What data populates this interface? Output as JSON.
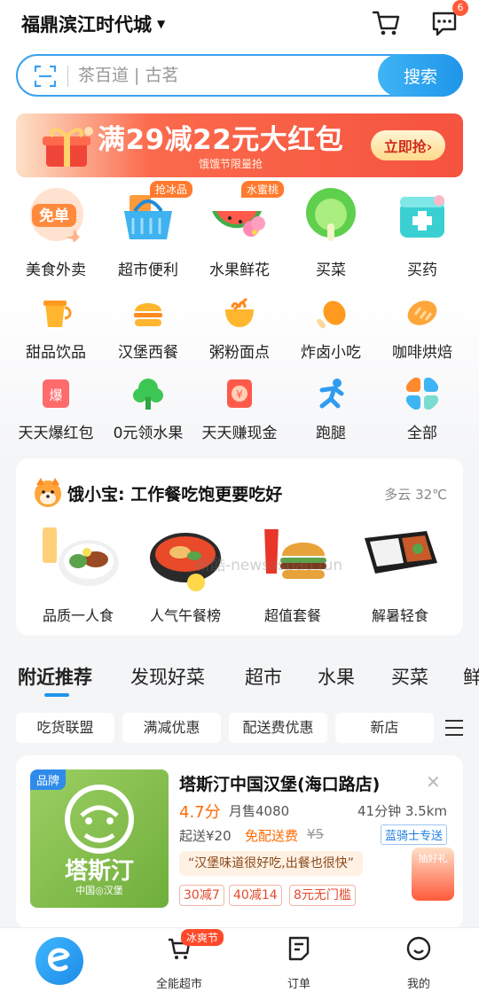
{
  "header": {
    "location": "福鼎滨江时代城",
    "message_count": "6"
  },
  "search": {
    "placeholder": "茶百道 | 古茗",
    "button": "搜索"
  },
  "banner": {
    "main_text": "满29减22元大红包",
    "sub_text": "饿饿节限量抢",
    "button": "立即抢›"
  },
  "categories": [
    [
      {
        "label": "美食外卖",
        "badge": "",
        "icon": "free-order-icon"
      },
      {
        "label": "超市便利",
        "badge": "抢冰品",
        "icon": "basket-icon"
      },
      {
        "label": "水果鲜花",
        "badge": "水蜜桃",
        "icon": "watermelon-flower-icon"
      },
      {
        "label": "买菜",
        "badge": "",
        "icon": "cabbage-icon"
      },
      {
        "label": "买药",
        "badge": "",
        "icon": "medicine-box-icon"
      }
    ],
    [
      {
        "label": "甜品饮品",
        "badge": "",
        "icon": "drink-icon"
      },
      {
        "label": "汉堡西餐",
        "badge": "",
        "icon": "burger-icon"
      },
      {
        "label": "粥粉面点",
        "badge": "",
        "icon": "noodle-bowl-icon"
      },
      {
        "label": "炸卤小吃",
        "badge": "",
        "icon": "drumstick-icon"
      },
      {
        "label": "咖啡烘焙",
        "badge": "",
        "icon": "bread-icon"
      }
    ],
    [
      {
        "label": "天天爆红包",
        "badge": "",
        "icon": "red-packet-icon"
      },
      {
        "label": "0元领水果",
        "badge": "",
        "icon": "tree-icon"
      },
      {
        "label": "天天赚现金",
        "badge": "",
        "icon": "cash-icon"
      },
      {
        "label": "跑腿",
        "badge": "",
        "icon": "runner-icon"
      },
      {
        "label": "全部",
        "badge": "",
        "icon": "grid-icon"
      }
    ]
  ],
  "xiaobao": {
    "title": "饿小宝: 工作餐吃饱更要吃好",
    "weather": "多云 32℃",
    "items": [
      "品质一人食",
      "人气午餐榜",
      "超值套餐",
      "解暑轻食"
    ],
    "watermark": "新酷-newsssbao.fun"
  },
  "tabs": [
    "附近推荐",
    "发现好菜",
    "超市",
    "水果",
    "买菜",
    "鲜"
  ],
  "filters": [
    "吃货联盟",
    "满减优惠",
    "配送费优惠",
    "新店"
  ],
  "store": {
    "brand_tag": "品牌",
    "logo_text": "塔斯汀",
    "logo_sub": "中国◎汉堡",
    "name": "塔斯汀中国汉堡(海口路店)",
    "rating": "4.7分",
    "monthly_sales": "月售4080",
    "eta": "41分钟 3.5km",
    "min_order": "起送¥20",
    "free_delivery": "免配送费",
    "original_fee": "¥5",
    "rider": "蓝骑士专送",
    "quote": "“汉堡味道很好吃,出餐也很快”",
    "promos": [
      "30减7",
      "40减14",
      "8元无门槛"
    ],
    "gift": "抽好礼"
  },
  "nav": {
    "items": [
      "全能超市",
      "订单",
      "我的"
    ],
    "badge": "冰爽节"
  },
  "colors": {
    "accent": "#1f95ea",
    "price_orange": "#ff6a00",
    "banner_red": "#f5533f"
  }
}
